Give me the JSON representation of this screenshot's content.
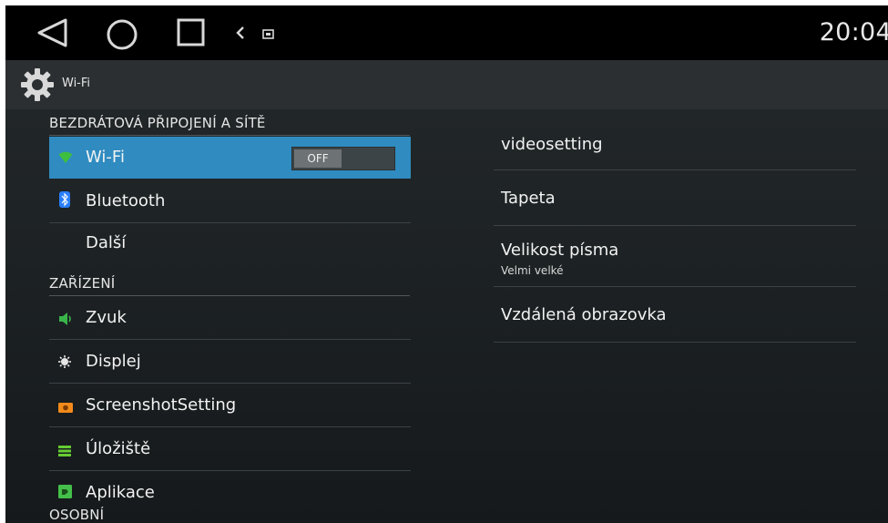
{
  "status_bar": {
    "time": "20:04"
  },
  "action_bar": {
    "title": "Wi-Fi"
  },
  "left_panel": {
    "section_wireless": "BEZDRÁTOVÁ PŘIPOJENÍ A SÍTĚ",
    "wifi": {
      "label": "Wi-Fi",
      "toggle": "OFF"
    },
    "bluetooth": {
      "label": "Bluetooth"
    },
    "more": {
      "label": "Další"
    },
    "section_device": "ZAŘÍZENÍ",
    "sound": {
      "label": "Zvuk"
    },
    "display": {
      "label": "Displej"
    },
    "screenshot": {
      "label": "ScreenshotSetting"
    },
    "storage": {
      "label": "Úložiště"
    },
    "apps": {
      "label": "Aplikace"
    },
    "section_personal": "OSOBNÍ"
  },
  "right_panel": {
    "items": [
      {
        "label": "videosetting"
      },
      {
        "label": "Tapeta"
      },
      {
        "label": "Velikost písma",
        "sub": "Velmi velké"
      },
      {
        "label": "Vzdálená obrazovka"
      }
    ]
  },
  "colors": {
    "highlight": "#2f8bc0",
    "wifi_icon": "#3fbf3f",
    "bluetooth_icon": "#2a7fff",
    "sound_icon": "#39b54a",
    "screenshot_icon": "#f28a1a",
    "storage_icon": "#66cc33",
    "apps_icon": "#44c04a"
  }
}
